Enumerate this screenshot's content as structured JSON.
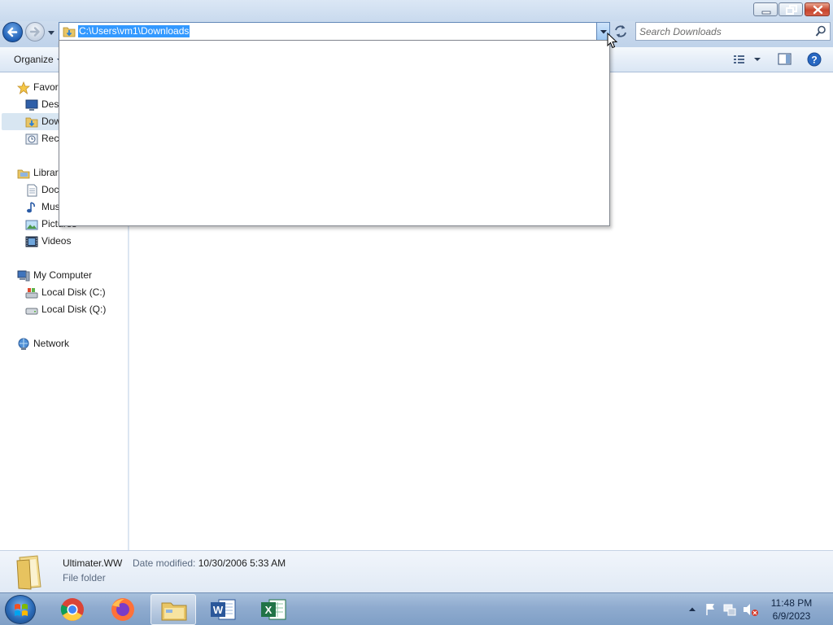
{
  "window": {
    "controls": {
      "minimize": "minimize-icon",
      "maximize": "maximize-icon",
      "close": "close-icon"
    }
  },
  "navbar": {
    "address": "C:\\Users\\vm1\\Downloads",
    "search_placeholder": "Search Downloads"
  },
  "toolbar": {
    "organize_label": "Organize"
  },
  "navpane": {
    "favorites": "Favori",
    "desktop": "Desk",
    "downloads": "Dow",
    "recent": "Rece",
    "libraries": "Librar",
    "documents": "Doc",
    "music": "Mus",
    "pictures": "Pictures",
    "videos": "Videos",
    "computer": "My Computer",
    "disk_c": "Local Disk (C:)",
    "disk_q": "Local Disk (Q:)",
    "network": "Network"
  },
  "details": {
    "name": "Ultimater.WW",
    "modified_label": "Date modified:",
    "modified_value": "10/30/2006 5:33 AM",
    "type": "File folder"
  },
  "taskbar": {
    "apps": [
      "chrome-icon",
      "firefox-icon",
      "explorer-icon",
      "word-icon",
      "excel-icon"
    ],
    "time": "11:48 PM",
    "date": "6/9/2023"
  },
  "colors": {
    "selection": "#3399ff",
    "close_button": "#c7452d",
    "taskbar": "#8fabcf"
  }
}
